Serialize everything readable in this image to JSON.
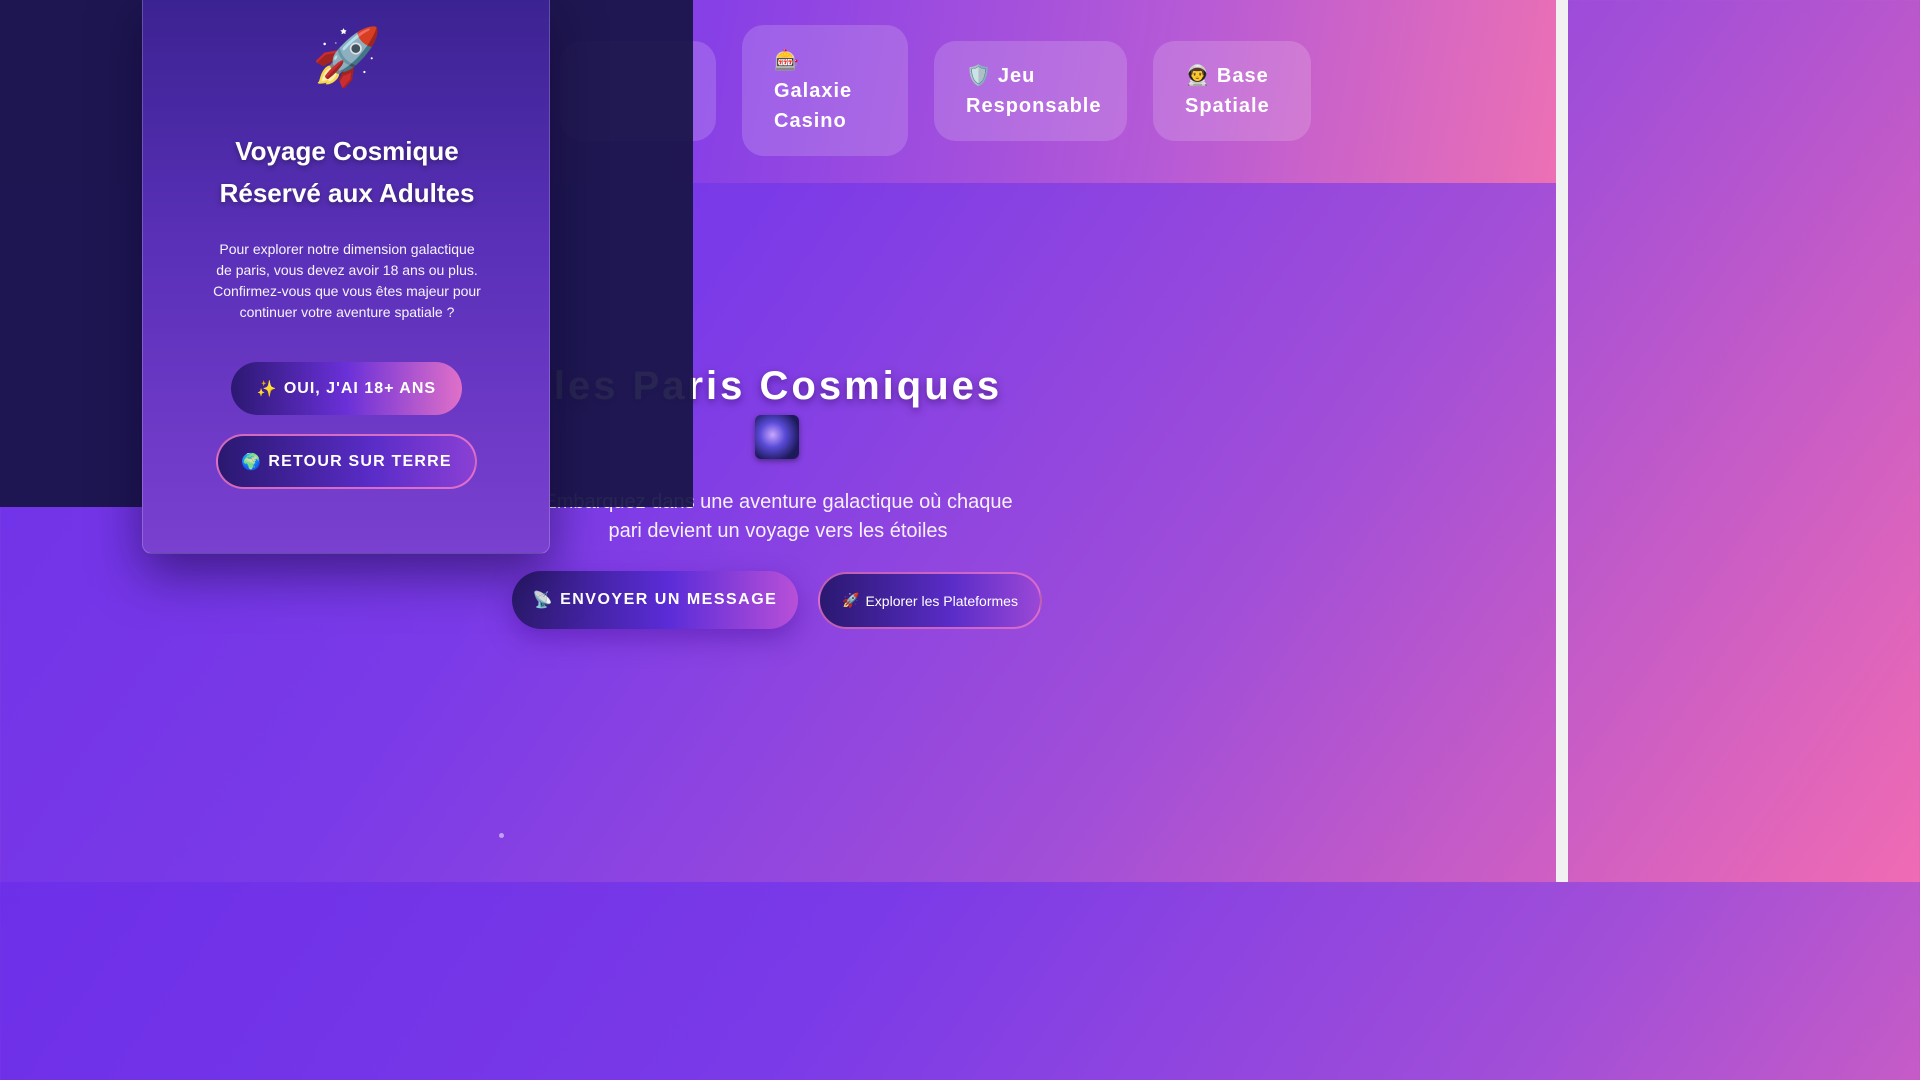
{
  "nav": {
    "casino": {
      "icon": "🎰",
      "label": "Galaxie Casino"
    },
    "jeu": {
      "icon": "🛡️",
      "label": "Jeu Responsable"
    },
    "base": {
      "icon": "👨‍🚀",
      "label": "Base Spatiale"
    }
  },
  "hero": {
    "title": "les Paris Cosmiques",
    "subtitle_line1": "Embarquez dans une aventure galactique où chaque",
    "subtitle_line2": "pari devient un voyage vers les étoiles",
    "primary_button": {
      "icon": "📡",
      "label": "ENVOYER UN MESSAGE"
    },
    "secondary_button": {
      "icon": "🚀",
      "label": "Explorer les Plateformes"
    },
    "emoji_icon": "milky-way-icon"
  },
  "age_modal": {
    "icon": "🚀",
    "title_line1": "Voyage Cosmique",
    "title_line2": "Réservé aux Adultes",
    "message": "Pour explorer notre dimension galactique de paris, vous devez avoir 18 ans ou plus. Confirmez-vous que vous êtes majeur pour continuer votre aventure spatiale ?",
    "confirm_button": {
      "icon": "✨",
      "label": "OUI, J'AI 18+ ANS"
    },
    "decline_button": {
      "icon": "🌍",
      "label": "RETOUR SUR TERRE"
    }
  },
  "colors": {
    "gradient_start": "#6d2fe8",
    "gradient_end": "#f06bb3",
    "overlay": "#18144a",
    "accent_pink": "#f078c8"
  }
}
